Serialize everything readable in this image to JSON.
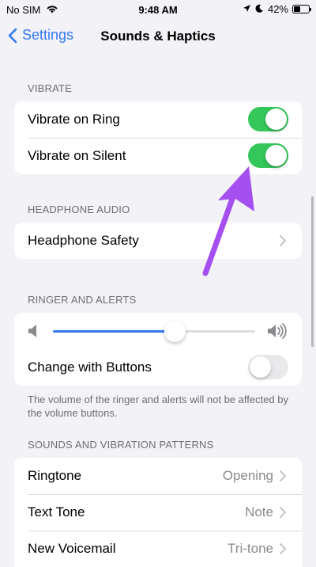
{
  "status_bar": {
    "carrier": "No SIM",
    "time": "9:48 AM",
    "battery_percent": "42%",
    "battery_level": 0.42
  },
  "nav": {
    "back_label": "Settings",
    "title": "Sounds & Haptics"
  },
  "vibrate": {
    "header": "VIBRATE",
    "items": [
      {
        "label": "Vibrate on Ring",
        "on": true
      },
      {
        "label": "Vibrate on Silent",
        "on": true
      }
    ]
  },
  "headphone_audio": {
    "header": "HEADPHONE AUDIO",
    "items": [
      {
        "label": "Headphone Safety"
      }
    ]
  },
  "ringer": {
    "header": "RINGER AND ALERTS",
    "volume_level": 0.6,
    "change_with_buttons_label": "Change with Buttons",
    "change_with_buttons_on": false,
    "footer": "The volume of the ringer and alerts will not be affected by the volume buttons."
  },
  "patterns": {
    "header": "SOUNDS AND VIBRATION PATTERNS",
    "items": [
      {
        "label": "Ringtone",
        "value": "Opening"
      },
      {
        "label": "Text Tone",
        "value": "Note"
      },
      {
        "label": "New Voicemail",
        "value": "Tri-tone"
      }
    ]
  },
  "colors": {
    "accent": "#3478f6",
    "toggle_on": "#34c759",
    "annotation_arrow": "#a64ff0"
  }
}
